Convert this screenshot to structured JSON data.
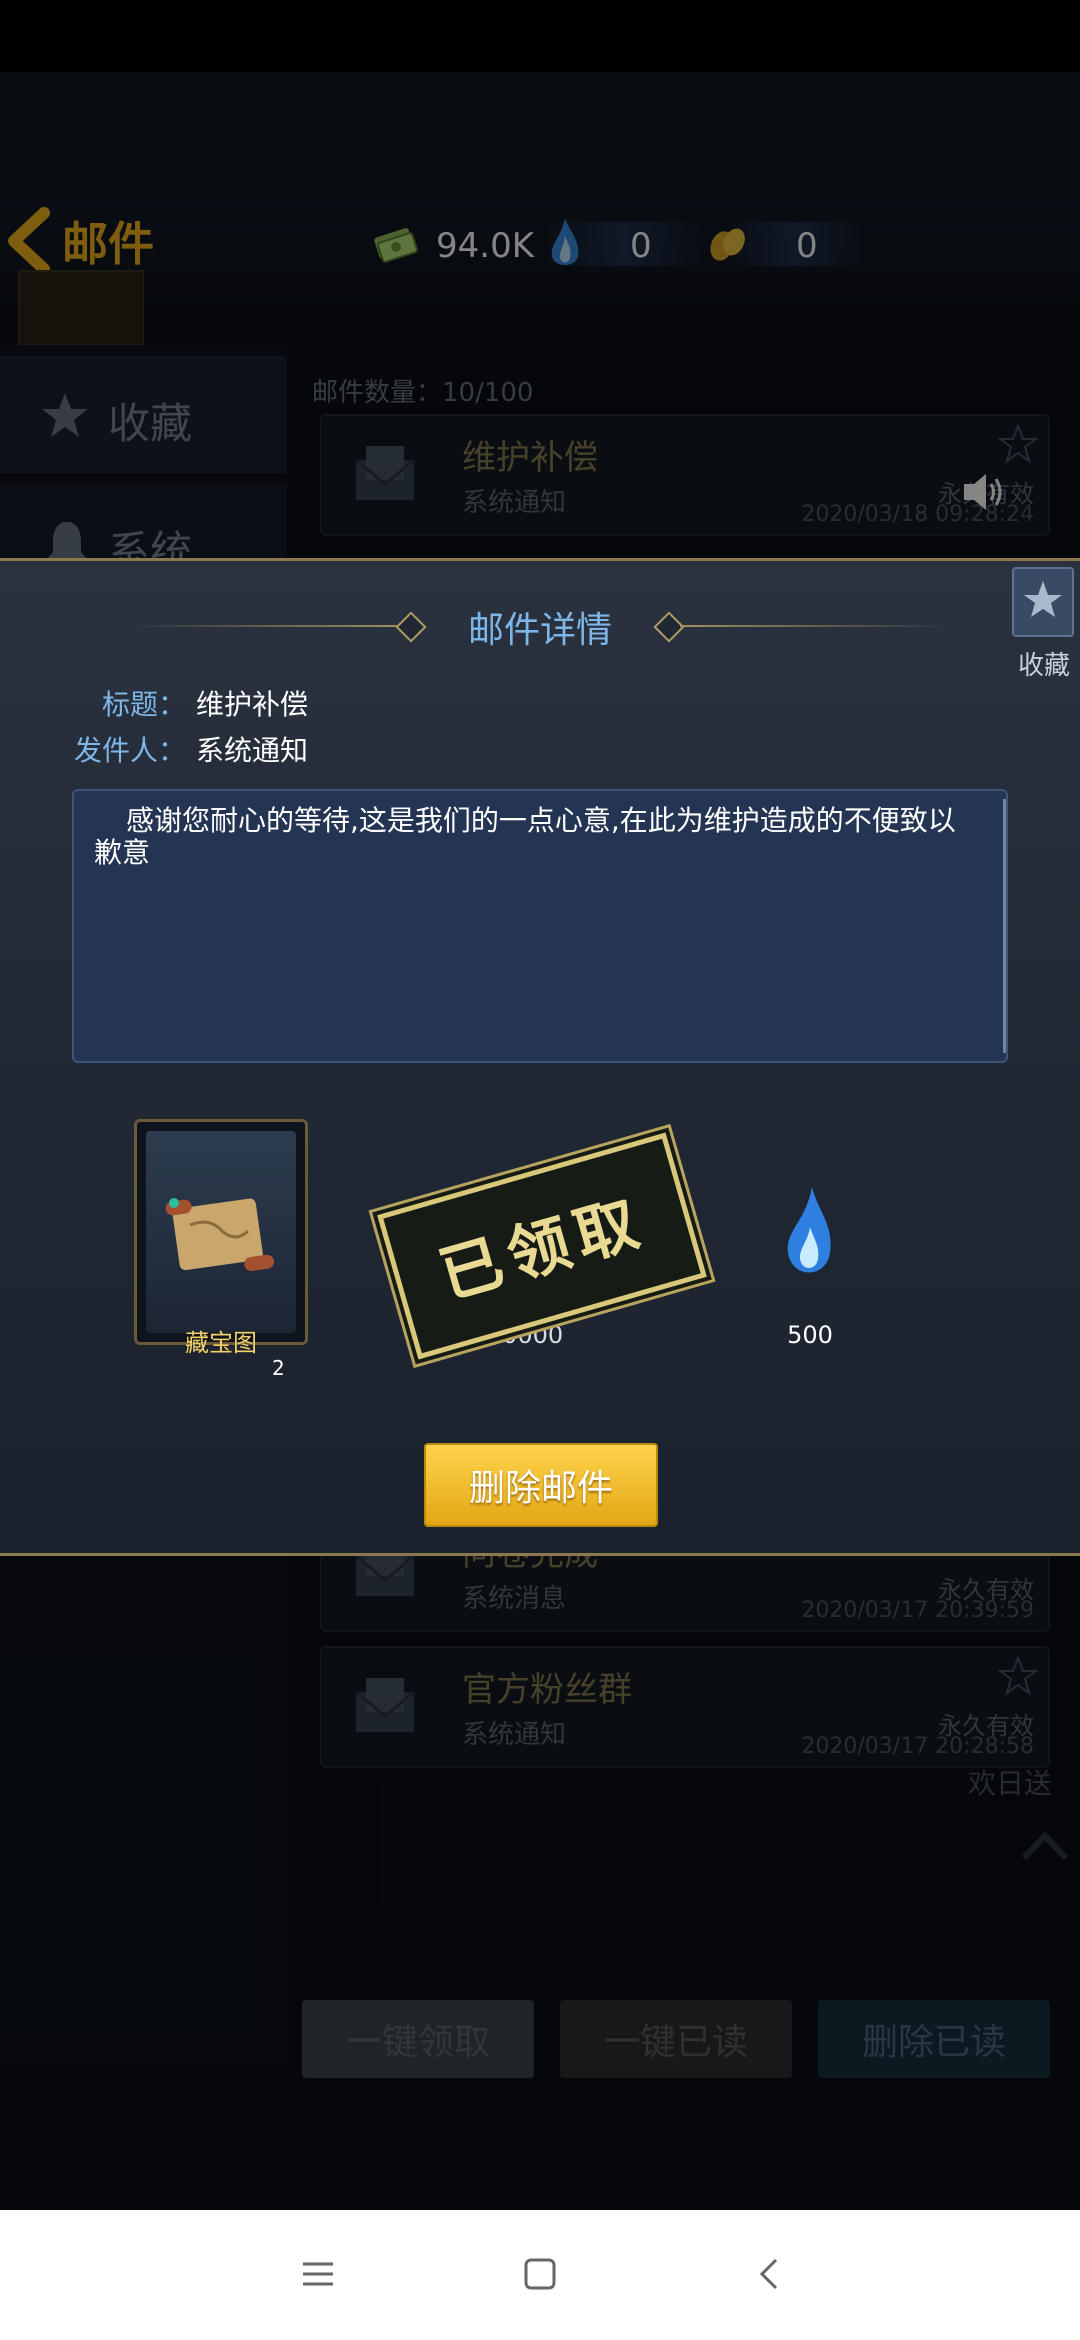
{
  "header": {
    "title": "邮件",
    "currencies": [
      {
        "icon": "cash-stack-icon",
        "value": "94.0K"
      },
      {
        "icon": "blue-flame-icon",
        "value": "0"
      },
      {
        "icon": "gold-bean-icon",
        "value": "0"
      }
    ]
  },
  "sidebar": {
    "tabs": [
      {
        "label": "收藏",
        "icon": "star-icon"
      },
      {
        "label": "系统",
        "icon": "bell-icon"
      }
    ]
  },
  "mail_list": {
    "count_label": "邮件数量：10/100",
    "items": [
      {
        "title": "维护补偿",
        "sender": "系统通知",
        "validity": "永久有效",
        "date": "2020/03/18 09:28:24"
      },
      {
        "title": "问卷完成",
        "sender": "系统消息",
        "validity": "永久有效",
        "date": "2020/03/17 20:39:59"
      },
      {
        "title": "官方粉丝群",
        "sender": "系统通知",
        "validity": "永久有效",
        "date": "2020/03/17 20:28:58"
      }
    ],
    "read_tag": "欢日送"
  },
  "bottom_buttons": {
    "claim_all": "一键领取",
    "read_all": "一键已读",
    "delete_read": "删除已读"
  },
  "modal": {
    "title": "邮件详情",
    "favorite_label": "收藏",
    "subject_label": "标题：",
    "subject_value": "维护补偿",
    "sender_label": "发件人：",
    "sender_value": "系统通知",
    "body": "感谢您耐心的等待,这是我们的一点心意,在此为维护造成的不便致以歉意",
    "rewards": [
      {
        "name": "藏宝图",
        "count": "2",
        "icon": "treasure-map-scroll-icon"
      },
      {
        "amount": "50000"
      },
      {
        "amount": "500",
        "icon": "blue-flame-icon"
      }
    ],
    "stamp_text": "已领取",
    "delete_button": "删除邮件"
  }
}
